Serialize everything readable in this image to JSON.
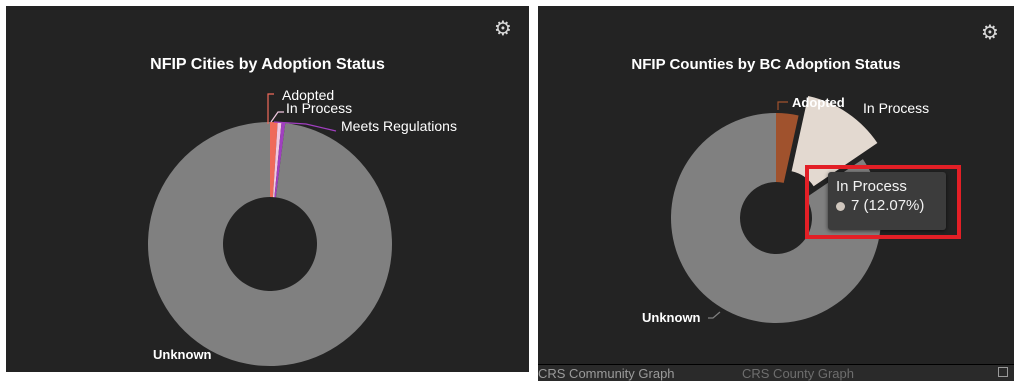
{
  "chart_data": [
    {
      "type": "pie",
      "title": "NFIP Cities by Adoption Status",
      "donut": true,
      "slices": [
        {
          "label": "Adopted",
          "value": 1,
          "color": "#ef6a5a"
        },
        {
          "label": "In Process",
          "value": 0.5,
          "color": "#f0c8e0"
        },
        {
          "label": "Meets Regulations",
          "value": 0.5,
          "color": "#a13fc0"
        },
        {
          "label": "Unknown",
          "value": 98,
          "color": "#808080"
        }
      ]
    },
    {
      "type": "pie",
      "title": "NFIP Counties by BC Adoption Status",
      "donut": true,
      "slices": [
        {
          "label": "Adopted",
          "value": 2,
          "color": "#a0522d"
        },
        {
          "label": "In Process",
          "value": 7,
          "color": "#e3d9d0"
        },
        {
          "label": "Unknown",
          "value": 49,
          "color": "#808080"
        }
      ],
      "tooltip": {
        "title": "In Process",
        "value": "7 (12.07%)"
      }
    }
  ],
  "icons": {
    "settings": "gear-icon"
  },
  "tabs": [
    "CRS Community Graph",
    "CRS County Graph"
  ]
}
